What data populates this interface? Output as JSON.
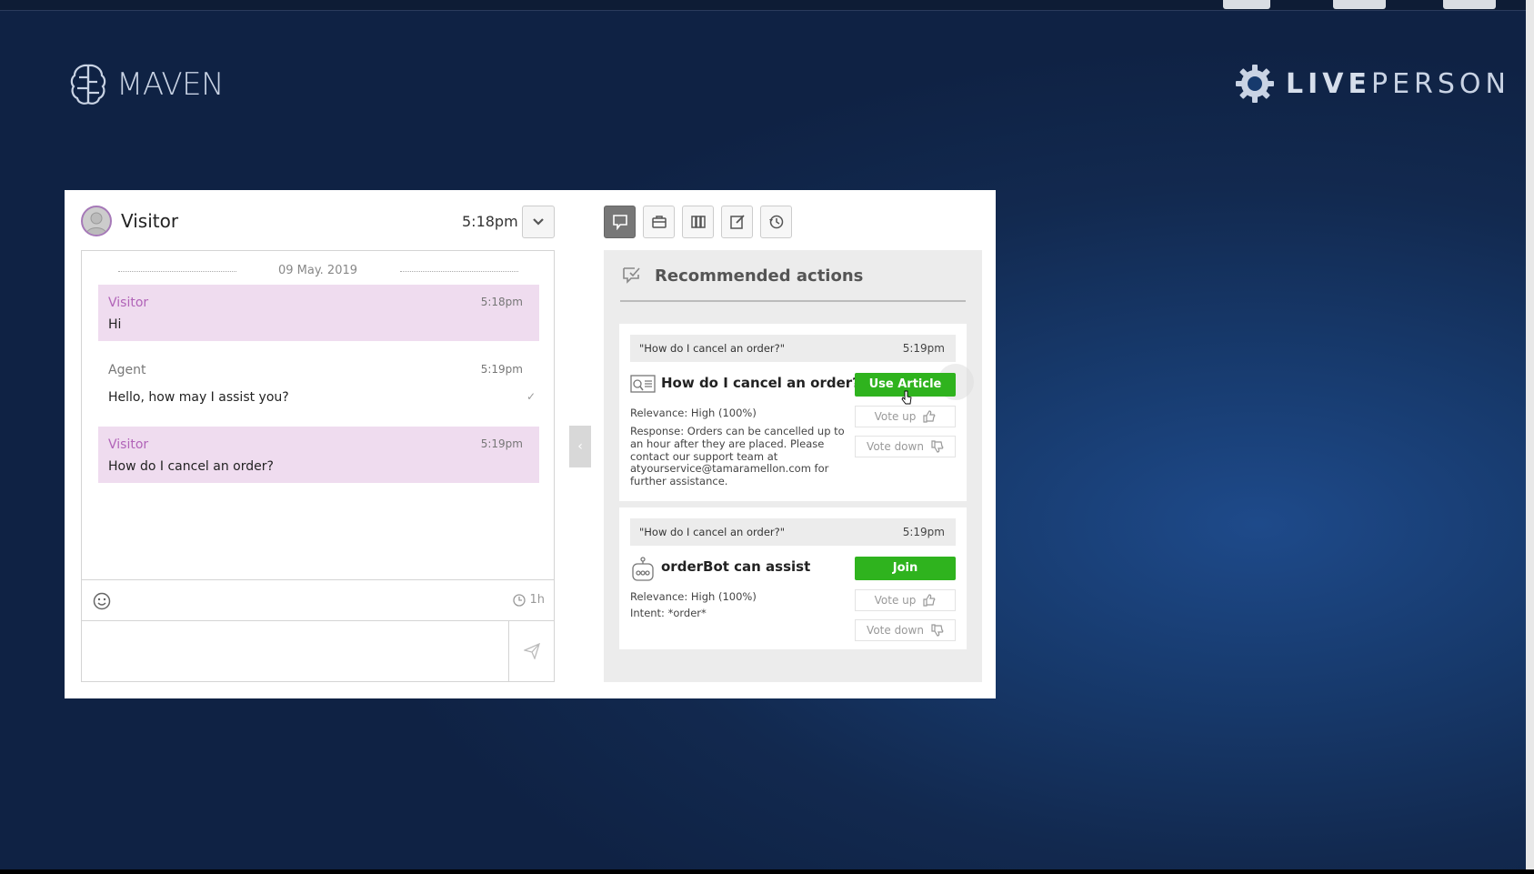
{
  "brand": {
    "maven": "MAVEN",
    "liveperson_bold": "LIVE",
    "liveperson_light": "PERSON"
  },
  "header": {
    "visitor_name": "Visitor",
    "time": "5:18pm"
  },
  "chat": {
    "date": "09 May. 2019",
    "messages": [
      {
        "sender": "Visitor",
        "time": "5:18pm",
        "text": "Hi"
      },
      {
        "sender": "Agent",
        "time": "5:19pm",
        "text": "Hello, how may I assist you?"
      },
      {
        "sender": "Visitor",
        "time": "5:19pm",
        "text": "How do I cancel an order?"
      }
    ],
    "timer": "1h"
  },
  "recommended": {
    "title": "Recommended actions",
    "cards": [
      {
        "query": "\"How do I cancel an order?\"",
        "query_time": "5:19pm",
        "title": "How do I cancel an order?",
        "action": "Use Article",
        "relevance": "Relevance: High (100%)",
        "response": "Response: Orders can be cancelled up to an hour after they are placed. Please contact our support team at atyourservice@tamaramellon.com for further assistance.",
        "vote_up": "Vote up",
        "vote_down": "Vote down"
      },
      {
        "query": "\"How do I cancel an order?\"",
        "query_time": "5:19pm",
        "title": "orderBot can assist",
        "action": "Join",
        "relevance": "Relevance: High (100%)",
        "intent": "Intent: *order*",
        "vote_up": "Vote up",
        "vote_down": "Vote down"
      }
    ]
  },
  "colors": {
    "accent_green": "#2fb31e",
    "visitor_bubble": "#efdcef",
    "visitor_name": "#b163b8"
  }
}
